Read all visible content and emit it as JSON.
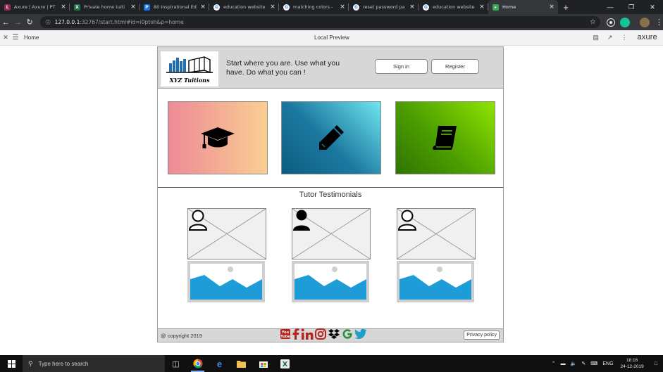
{
  "browser": {
    "tabs": [
      {
        "title": "Axure | Axure | PT",
        "icon": "L",
        "color": "#9c2755",
        "active": false
      },
      {
        "title": "Private home tuiti",
        "icon": "X",
        "color": "#217346",
        "active": false
      },
      {
        "title": "80 Inspirational Ed",
        "icon": "P",
        "color": "#1a73e8",
        "active": false
      },
      {
        "title": "education website",
        "icon": "G",
        "color": "#ffffff",
        "active": false
      },
      {
        "title": "matching colors -",
        "icon": "G",
        "color": "#ffffff",
        "active": false
      },
      {
        "title": "reset password pa",
        "icon": "G",
        "color": "#ffffff",
        "active": false
      },
      {
        "title": "education website",
        "icon": "G",
        "color": "#ffffff",
        "active": false
      },
      {
        "title": "Home",
        "icon": "▸",
        "color": "#3ba55c",
        "active": true
      }
    ],
    "url_host": "127.0.0.1",
    "url_rest": ":32767/start.html#id=i0ptoh&p=home"
  },
  "axure": {
    "page_name": "Home",
    "center_label": "Local Preview",
    "brand": "axure"
  },
  "site": {
    "logo_text": "XYZ Tuitions",
    "tagline": "Start where you are. Use what you have. Do what you can !",
    "signin_label": "Sign in",
    "register_label": "Register",
    "cards": [
      {
        "icon": "graduation-cap-icon"
      },
      {
        "icon": "pencil-icon"
      },
      {
        "icon": "book-icon"
      }
    ],
    "testimonials_title": "Tutor Testimonials",
    "footer": {
      "copyright": "@ copyright 2019",
      "social": [
        "youtube-icon",
        "facebook-icon",
        "linkedin-icon",
        "instagram-icon",
        "dropbox-icon",
        "google-icon",
        "twitter-icon"
      ],
      "privacy_label": "Privacy policy"
    }
  },
  "taskbar": {
    "search_placeholder": "Type here to search",
    "lang": "ENG",
    "time": "18:16",
    "date": "24-12-2019"
  }
}
